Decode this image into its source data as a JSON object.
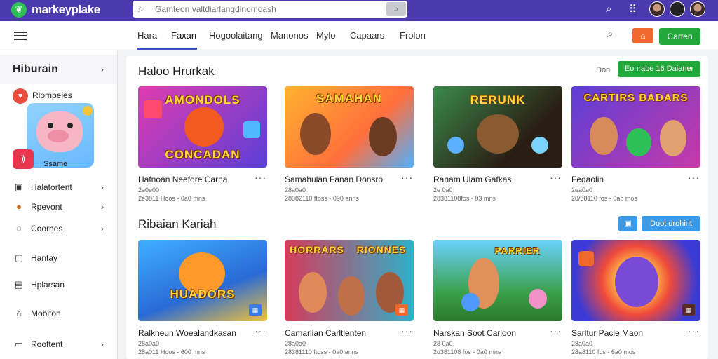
{
  "topbar": {
    "logo_text": "markeyplake",
    "logo_icon": "leaf-icon",
    "search_placeholder": "Gamteon valtdiarlangdinomoash",
    "search_button_icon": "search-icon"
  },
  "nav": {
    "tabs": [
      "Hara",
      "Faxan",
      "Hogoolaitang",
      "Manonos",
      "Mylo",
      "Capaars",
      "Frolon"
    ],
    "active_tab": "Faxan",
    "cta": "Carten"
  },
  "sidebar": {
    "header": "Hiburain",
    "featured": {
      "label": "Rlompeles",
      "icon": "heart-icon"
    },
    "promo": {
      "label": "Ssame",
      "icon": "tag-icon"
    },
    "items": [
      {
        "label": "Halatortent",
        "icon": "gamepad-icon",
        "chevron": true
      },
      {
        "label": "Rpevont",
        "icon": "bear-icon",
        "chevron": true
      },
      {
        "label": "Coorhes",
        "icon": "puzzle-icon",
        "chevron": true
      },
      {
        "label": "Hantay",
        "icon": "chat-icon",
        "chevron": false
      },
      {
        "label": "Hplarsan",
        "icon": "document-icon",
        "chevron": false
      },
      {
        "label": "Mobiton",
        "icon": "home-icon",
        "chevron": false
      },
      {
        "label": "Rooftent",
        "icon": "gift-icon",
        "chevron": true
      }
    ]
  },
  "section1": {
    "title": "Haloo Hrurkak",
    "link": "Don",
    "button": "Eonrabe 16 Daianer",
    "cards": [
      {
        "title": "Hafnoan Neefore Carna",
        "meta1": "2e0e00",
        "meta2": "2e3811 Hoos - 0a0 mns",
        "art": "AMONDOLS",
        "art2": "CONCADAN"
      },
      {
        "title": "Samahulan Fanan Donsro",
        "meta1": "28a0a0",
        "meta2": "28382110 ftoss - 090 anns",
        "art": "SAMAHAN",
        "art2": ""
      },
      {
        "title": "Ranam Ulam Gafkas",
        "meta1": "2e 0a0",
        "meta2": "28381108fos - 03 mns",
        "art": "RERUNK",
        "art2": ""
      },
      {
        "title": "Fedaolin",
        "meta1": "2ea0a0",
        "meta2": "28/88110 fos - 0ab mos",
        "art": "CARTIRS BADARS",
        "art2": ""
      }
    ]
  },
  "section2": {
    "title": "Ribaian Kariah",
    "button": "Doot drohint",
    "cards": [
      {
        "title": "Ralkneun Woealandkasan",
        "meta1": "28a0a0",
        "meta2": "28a011 Hoos - 600 mns",
        "art": "HUADORS",
        "art2": ""
      },
      {
        "title": "Camarlian Carltlenten",
        "meta1": "28a0a0",
        "meta2": "28381110 ftoss - 0a0 anns",
        "art": "HORRARS",
        "art2": "RIONNES"
      },
      {
        "title": "Narskan Soot Carloon",
        "meta1": "28 0a0",
        "meta2": "2d381108 fos - 0a0 mns",
        "art": "PARRIER",
        "art2": ""
      },
      {
        "title": "Sarltur Pacle Maon",
        "meta1": "28a0a0",
        "meta2": "28a8110 fos - 6a0 mos",
        "art": "",
        "art2": ""
      }
    ]
  },
  "colors": {
    "topbar": "#4b3aae",
    "accent_green": "#22a83a",
    "accent_blue": "#3b9be8",
    "accent_orange": "#f0682e"
  }
}
